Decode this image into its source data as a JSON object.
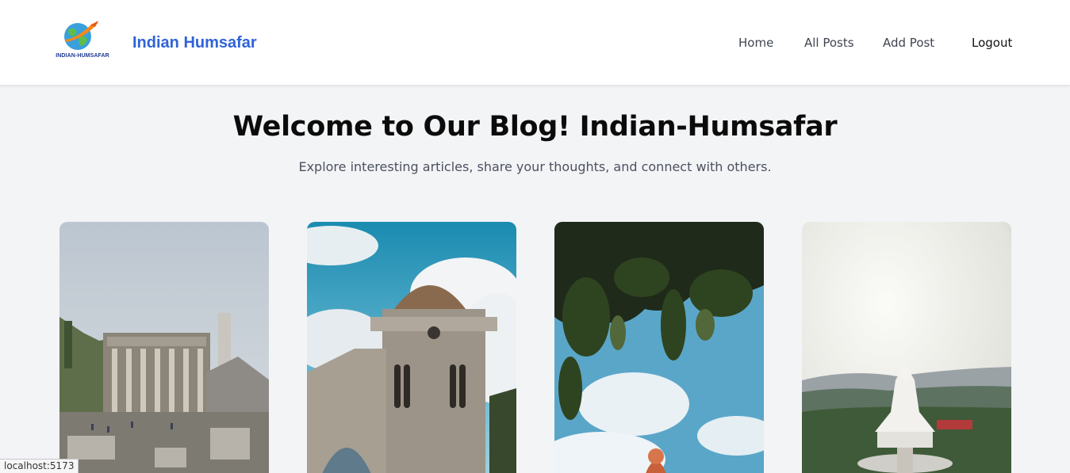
{
  "header": {
    "logo_text": "INDIAN-HUMSAFAR",
    "brand": "Indian Humsafar",
    "nav": {
      "home": "Home",
      "all_posts": "All Posts",
      "add_post": "Add Post",
      "logout": "Logout"
    }
  },
  "hero": {
    "title": "Welcome to Our Blog! Indian-Humsafar",
    "subtitle": "Explore interesting articles, share your thoughts, and connect with others."
  },
  "posts": [
    {
      "image": "ancient-library-ruins-photo"
    },
    {
      "image": "domed-church-tower-photo"
    },
    {
      "image": "leaves-sky-temple-spire-photo"
    },
    {
      "image": "white-buddha-statue-hills-photo"
    }
  ],
  "status_bar": {
    "url": "localhost:5173"
  },
  "colors": {
    "brand": "#2f63d8",
    "background": "#f3f4f6"
  }
}
